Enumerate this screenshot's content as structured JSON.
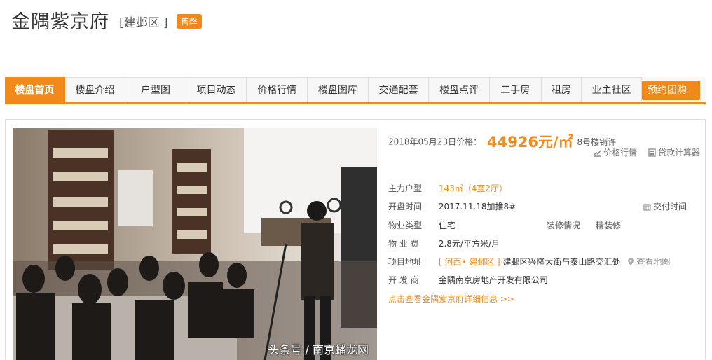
{
  "header": {
    "title": "金隅紫京府",
    "district": "[建邺区 ]",
    "status": "售罄"
  },
  "nav": {
    "items": [
      "楼盘首页",
      "楼盘介绍",
      "户型图",
      "项目动态",
      "价格行情",
      "楼盘图库",
      "交通配套",
      "楼盘点评",
      "二手房",
      "租房",
      "业主社区"
    ],
    "preorder": "预约团购"
  },
  "info": {
    "price_date": "2018年05月23日价格：",
    "price_value": "44926元/㎡",
    "price_note": "8号楼销许",
    "tool_price": "价格行情",
    "tool_loan": "贷款计算器",
    "rows": {
      "layout": {
        "label": "主力户型",
        "value": "143㎡（4室2厅）"
      },
      "open": {
        "label": "开盘时间",
        "value": "2017.11.18加推8#",
        "extra": "交付时间"
      },
      "type": {
        "label": "物业类型",
        "value": "住宅",
        "sub_label": "装修情况",
        "sub_value": "精装修"
      },
      "fee": {
        "label": "物 业 费",
        "value": "2.8元/平方米/月"
      },
      "address": {
        "label": "项目地址",
        "region": "[ 河西• 建邺区 ]",
        "street": "建邺区兴隆大街与泰山路交汇处",
        "map": "查看地图"
      },
      "developer": {
        "label": "开 发 商",
        "value": "金隅南京房地产开发有限公司"
      }
    },
    "detail_link": "点击查看金隅紫京府详细信息 >>"
  },
  "watermark": "头条号 / 南京蟠龙网",
  "colors": {
    "accent": "#f08a1d"
  }
}
